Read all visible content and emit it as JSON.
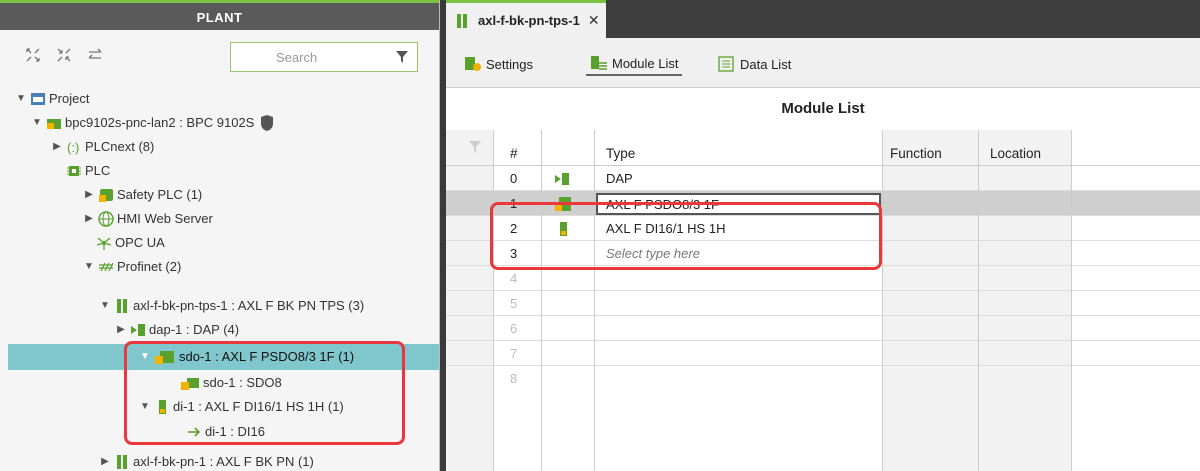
{
  "left_panel": {
    "title": "PLANT",
    "search_placeholder": "Search",
    "toolbar_icons": [
      "expand-all-icon",
      "collapse-all-icon",
      "sync-icon"
    ],
    "tree": [
      {
        "label": "Project",
        "icon": "project-icon"
      },
      {
        "label": "bpc9102s-pnc-lan2 : BPC 9102S",
        "icon": "controller-icon"
      },
      {
        "label": "PLCnext (8)",
        "icon": "plcnext-icon"
      },
      {
        "label": "PLC",
        "icon": "plc-icon"
      },
      {
        "label": "Safety PLC (1)",
        "icon": "safety-plc-icon"
      },
      {
        "label": "HMI Web Server",
        "icon": "globe-icon"
      },
      {
        "label": "OPC UA",
        "icon": "opcua-icon"
      },
      {
        "label": "Profinet (2)",
        "icon": "profinet-icon"
      },
      {
        "label": "axl-f-bk-pn-tps-1 : AXL F BK PN TPS (3)",
        "icon": "bus-coupler-icon"
      },
      {
        "label": "dap-1 : DAP (4)",
        "icon": "dap-icon"
      },
      {
        "label": "sdo-1 : AXL F PSDO8/3 1F (1)",
        "icon": "safety-module-icon"
      },
      {
        "label": "sdo-1 : SDO8",
        "icon": "sdo-icon"
      },
      {
        "label": "di-1 : AXL F DI16/1 HS 1H (1)",
        "icon": "io-module-icon"
      },
      {
        "label": "di-1 : DI16",
        "icon": "arrow-right-icon"
      },
      {
        "label": "axl-f-bk-pn-1 : AXL F BK PN (1)",
        "icon": "bus-coupler-icon"
      }
    ]
  },
  "editor": {
    "tab_label": "axl-f-bk-pn-tps-1",
    "toolbar": {
      "settings": "Settings",
      "module_list": "Module List",
      "data_list": "Data List"
    },
    "title": "Module List",
    "columns": {
      "index": "#",
      "type": "Type",
      "function": "Function",
      "location": "Location"
    },
    "rows": [
      {
        "index": "0",
        "type": "DAP"
      },
      {
        "index": "1",
        "type": "AXL F PSDO8/3 1F"
      },
      {
        "index": "2",
        "type": "AXL F DI16/1 HS 1H"
      },
      {
        "index": "3",
        "type": "Select type here"
      },
      {
        "index": "4",
        "type": ""
      },
      {
        "index": "5",
        "type": ""
      },
      {
        "index": "6",
        "type": ""
      },
      {
        "index": "7",
        "type": ""
      },
      {
        "index": "8",
        "type": ""
      }
    ]
  },
  "colors": {
    "accent_green": "#7cc242",
    "selection": "#7fc7cc",
    "highlight_box": "#e8383d"
  }
}
